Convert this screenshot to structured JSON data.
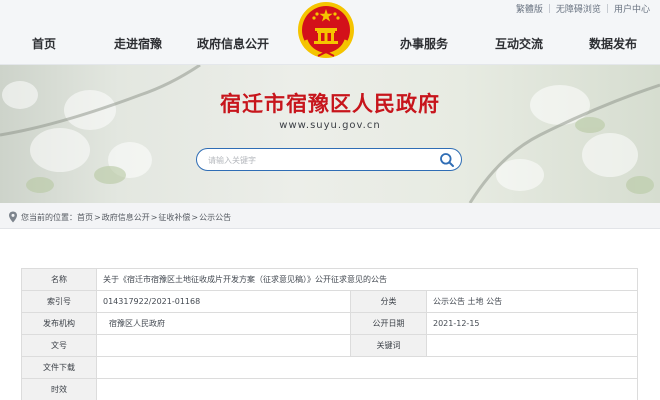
{
  "utility_links": [
    "繁體版",
    "无障碍浏览",
    "用户中心"
  ],
  "nav": {
    "left": [
      "首页",
      "走进宿豫",
      "政府信息公开"
    ],
    "right": [
      "办事服务",
      "互动交流",
      "数据发布"
    ]
  },
  "banner": {
    "title": "宿迁市宿豫区人民政府",
    "url": "www.suyu.gov.cn"
  },
  "search": {
    "placeholder": "请输入关键字",
    "icon": "search-icon"
  },
  "breadcrumb": {
    "label": "您当前的位置：",
    "items": [
      "首页",
      "政府信息公开",
      "征收补偿",
      "公示公告"
    ]
  },
  "info_table": {
    "name_label": "名称",
    "name_value": "关于《宿迁市宿豫区土地征收成片开发方案（征求意见稿）》公开征求意见的公告",
    "index_label": "索引号",
    "index_value": "014317922/2021-01168",
    "category_label": "分类",
    "category_value": "公示公告   土地   公告",
    "agency_label": "发布机构",
    "agency_value": "宿豫区人民政府",
    "date_label": "公开日期",
    "date_value": "2021-12-15",
    "docno_label": "文号",
    "docno_value": "",
    "keywords_label": "关键词",
    "keywords_value": "",
    "download_label": "文件下载",
    "download_value": "",
    "validity_label": "时效",
    "validity_value": ""
  },
  "colors": {
    "title_red": "#c7151c",
    "search_border": "#2f6db5",
    "nav_bg": "#f4f6f8",
    "emblem_red": "#d3111a",
    "emblem_gold": "#f5c400"
  }
}
